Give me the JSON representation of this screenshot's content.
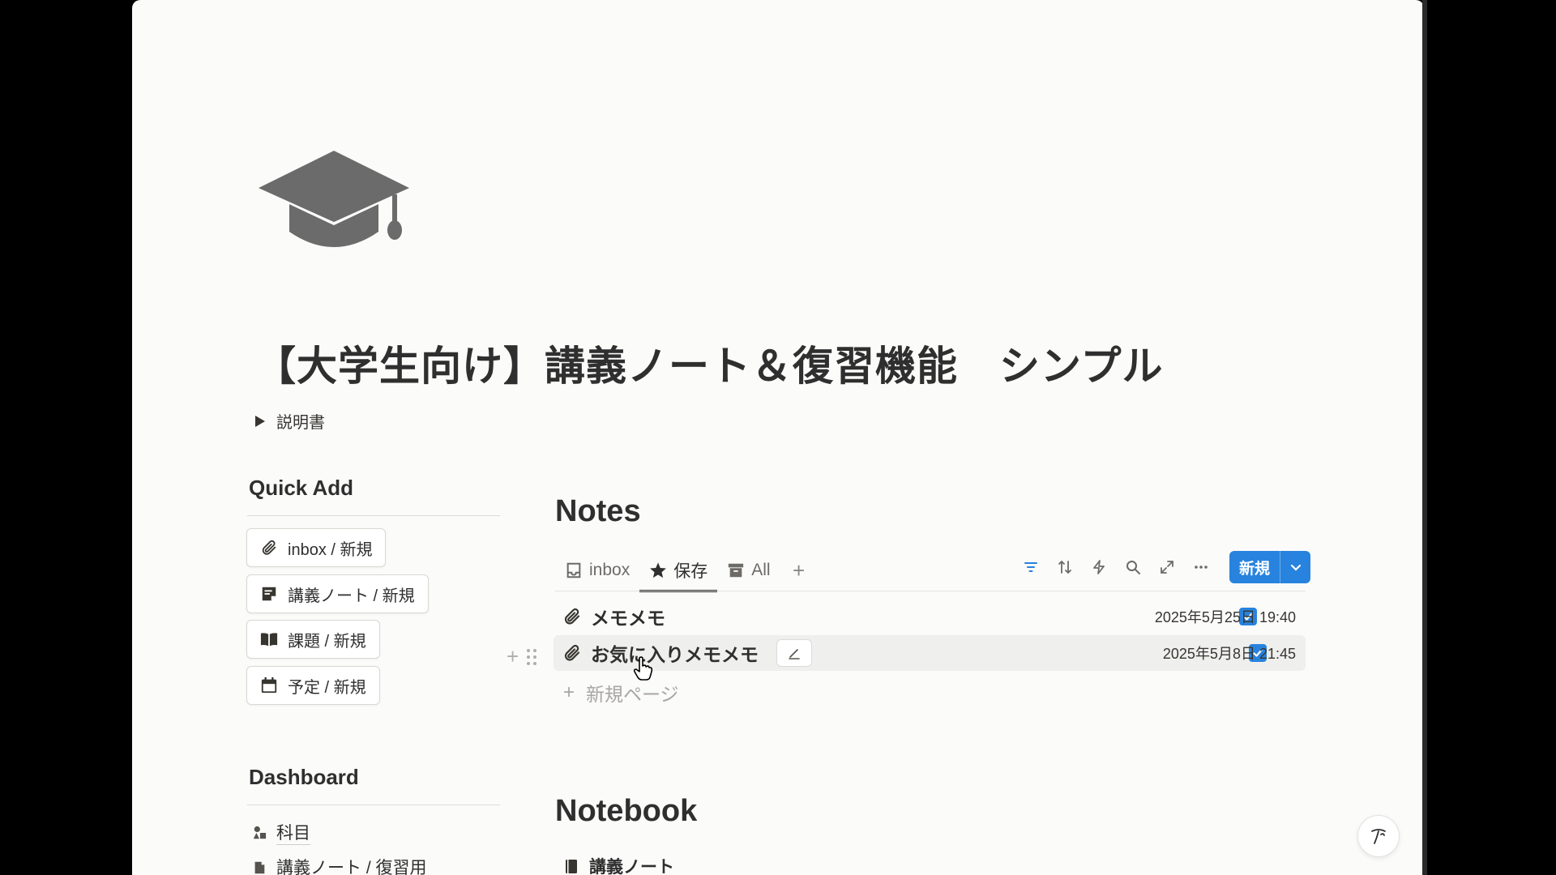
{
  "page": {
    "title": "【大学生向け】講義ノート＆復習機能　シンプル",
    "icon": "graduation-cap-icon",
    "toggle_label": "説明書"
  },
  "quick_add": {
    "heading": "Quick Add",
    "buttons": [
      {
        "label": "inbox / 新規",
        "icon": "paperclip-icon"
      },
      {
        "label": "講義ノート / 新規",
        "icon": "note-icon"
      },
      {
        "label": "課題 / 新規",
        "icon": "open-book-icon"
      },
      {
        "label": "予定 / 新規",
        "icon": "calendar-icon"
      }
    ]
  },
  "dashboard": {
    "heading": "Dashboard",
    "items": [
      {
        "label": "科目",
        "icon": "shapes-icon"
      },
      {
        "label": "講義ノート / 復習用",
        "icon": "document-icon"
      }
    ]
  },
  "notes_db": {
    "title": "Notes",
    "tabs": [
      {
        "label": "inbox",
        "icon": "inbox-tray-icon"
      },
      {
        "label": "保存",
        "icon": "star-icon"
      },
      {
        "label": "All",
        "icon": "archive-icon"
      }
    ],
    "active_tab": "保存",
    "new_button_label": "新規",
    "rows": [
      {
        "name": "メモメモ",
        "checked": true,
        "date": "2025年5月25日 19:40"
      },
      {
        "name": "お気に入りメモメモ",
        "checked": true,
        "date": "2025年5月8日 21:45"
      }
    ],
    "new_page_label": "新規ページ"
  },
  "notebook_db": {
    "title": "Notebook",
    "items": [
      {
        "label": "講義ノート",
        "icon": "notebook-icon"
      }
    ]
  },
  "colors": {
    "accent": "#2783de",
    "page_bg": "#fbfbfa",
    "text": "#2f2f2f"
  }
}
